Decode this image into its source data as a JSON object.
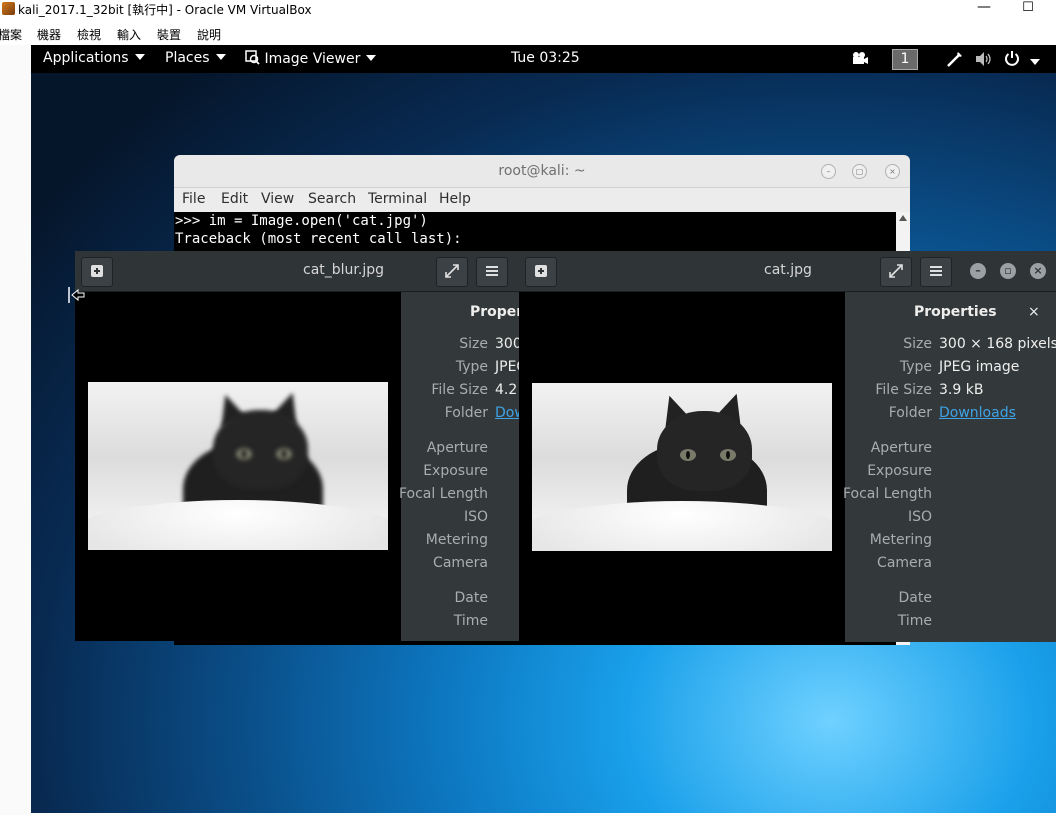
{
  "host": {
    "window_title": "kali_2017.1_32bit [執行中] - Oracle VM VirtualBox",
    "min_label": "—",
    "max_label": "☐",
    "menu": [
      "檔案",
      "機器",
      "檢視",
      "輸入",
      "裝置",
      "說明"
    ]
  },
  "topbar": {
    "applications": "Applications",
    "places": "Places",
    "image_viewer": "Image Viewer",
    "clock": "Tue 03:25",
    "workspace": "1"
  },
  "terminal": {
    "title": "root@kali: ~",
    "menu": [
      "File",
      "Edit",
      "View",
      "Search",
      "Terminal",
      "Help"
    ],
    "lines": [
      ">>> im = Image.open('cat.jpg')",
      "Traceback (most recent call last):"
    ]
  },
  "viewer_blur": {
    "title": "cat_blur.jpg",
    "properties_title": "Propert",
    "size_value": "300",
    "type_value": "JPEG",
    "file_size_value": "4.2",
    "folder_value": "Dow"
  },
  "viewer_cat": {
    "title": "cat.jpg",
    "properties_title": "Properties",
    "close_label": "×",
    "size_value": "300 × 168 pixels",
    "type_value": "JPEG image",
    "file_size_value": "3.9 kB",
    "folder_value": "Downloads"
  },
  "property_labels": {
    "size": "Size",
    "type": "Type",
    "file_size": "File Size",
    "folder": "Folder",
    "aperture": "Aperture",
    "exposure": "Exposure",
    "focal_length": "Focal Length",
    "iso": "ISO",
    "metering": "Metering",
    "camera": "Camera",
    "date": "Date",
    "time": "Time"
  },
  "icons": {
    "new_window": "plus-square-icon",
    "fullscreen": "expand-icon",
    "menu": "hamburger-icon",
    "minimize": "minimize-icon",
    "maximize": "maximize-icon",
    "close": "close-icon"
  },
  "colors": {
    "topbar": "#000000",
    "header_bar": "#2f3437",
    "sidebar": "#33393b",
    "link": "#3fa2e6"
  }
}
